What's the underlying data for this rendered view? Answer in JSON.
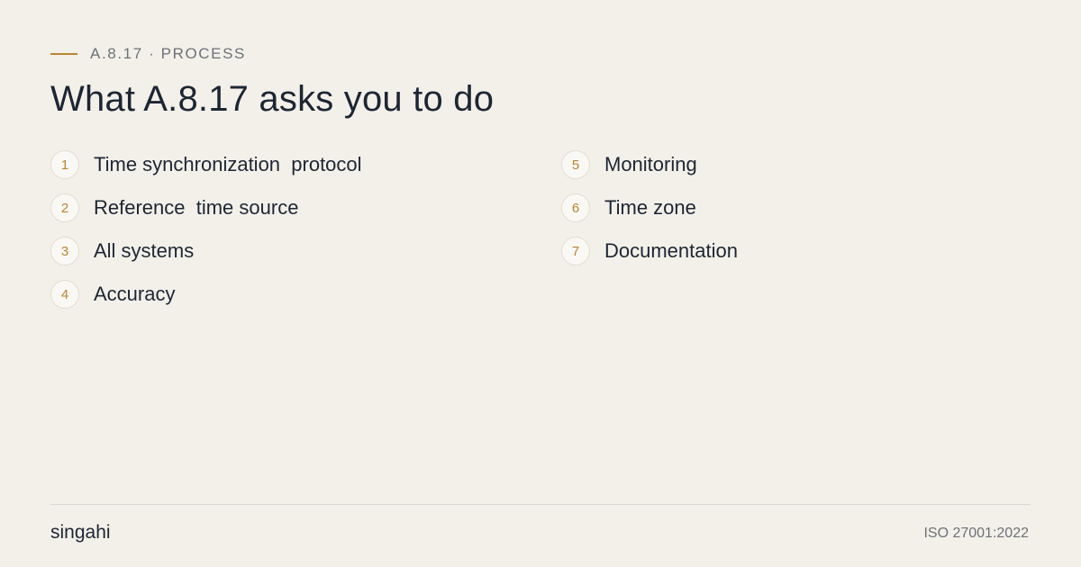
{
  "eyebrow": "A.8.17 · PROCESS",
  "title": "What A.8.17 asks you to do",
  "items_left": [
    {
      "number": "1",
      "label": "Time synchronization  protocol"
    },
    {
      "number": "2",
      "label": "Reference  time source"
    },
    {
      "number": "3",
      "label": "All systems"
    },
    {
      "number": "4",
      "label": "Accuracy"
    }
  ],
  "items_right": [
    {
      "number": "5",
      "label": "Monitoring"
    },
    {
      "number": "6",
      "label": "Time zone"
    },
    {
      "number": "7",
      "label": "Documentation"
    }
  ],
  "footer": {
    "brand": "singahi",
    "standard": "ISO 27001:2022"
  },
  "colors": {
    "background": "#f3f0ea",
    "accent": "#b8862f",
    "text": "#1d2633",
    "muted": "#6d7178"
  }
}
